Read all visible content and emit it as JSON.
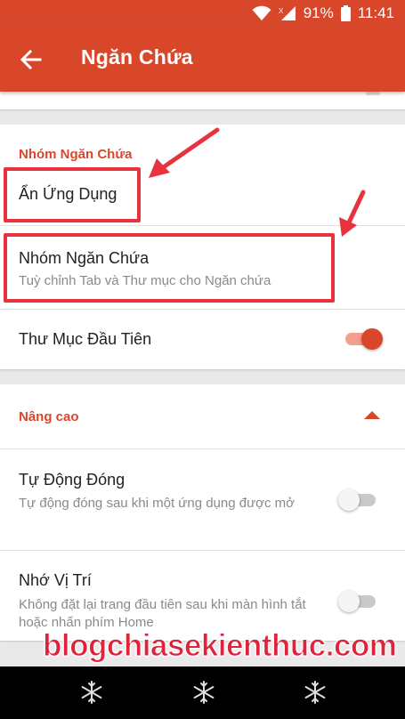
{
  "status_bar": {
    "battery": "91%",
    "time": "11:41",
    "icons": [
      "wifi-icon",
      "signal-icon",
      "battery-icon"
    ]
  },
  "app_bar": {
    "title": "Ngăn Chứa",
    "back_icon": "arrow-back-icon"
  },
  "group_section": {
    "header": "Nhóm Ngăn Chứa",
    "items": [
      {
        "title": "Ẩn Ứng Dụng"
      },
      {
        "title": "Nhóm Ngăn Chứa",
        "subtitle": "Tuỳ chỉnh Tab và Thư mục cho Ngăn chứa"
      },
      {
        "title": "Thư Mục Đầu Tiên",
        "toggle": true
      }
    ]
  },
  "advanced_section": {
    "header": "Nâng cao",
    "expanded": true,
    "items": [
      {
        "title": "Tự Động Đóng",
        "subtitle": "Tự động đóng sau khi một ứng dụng được mở",
        "toggle": false
      },
      {
        "title": "Nhớ Vị Trí",
        "subtitle": "Không đặt lại trang đầu tiên sau khi màn hình tắt hoặc nhấn phím Home",
        "toggle": false
      }
    ]
  },
  "watermark": "blogchiasekienthuc.com",
  "nav_bar": {
    "icons": [
      "snowflake-icon",
      "snowflake-icon",
      "snowflake-icon"
    ]
  },
  "colors": {
    "accent": "#d9472b",
    "annotation": "#e8333f",
    "nav_background": "#000000"
  }
}
